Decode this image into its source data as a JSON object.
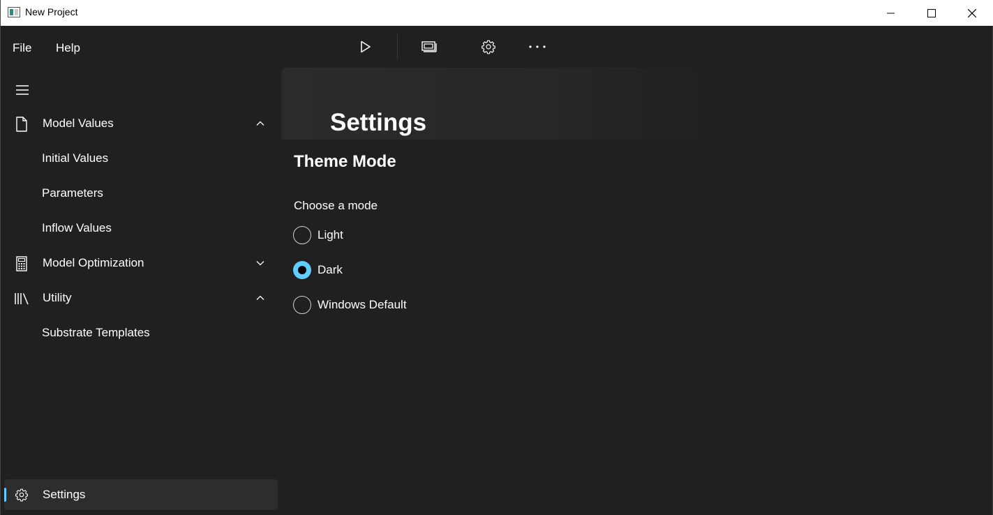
{
  "window": {
    "title": "New Project"
  },
  "menubar": {
    "items": [
      {
        "label": "File"
      },
      {
        "label": "Help"
      }
    ]
  },
  "commandbar": {
    "icons": [
      "play-icon",
      "screens-icon",
      "gear-icon",
      "more-icon"
    ]
  },
  "nav": {
    "items": [
      {
        "label": "Model Values",
        "icon": "document-icon",
        "expanded": true
      },
      {
        "label": "Initial Values"
      },
      {
        "label": "Parameters"
      },
      {
        "label": "Inflow Values"
      },
      {
        "label": "Model Optimization",
        "icon": "calculator-icon",
        "expanded": false
      },
      {
        "label": "Utility",
        "icon": "library-icon",
        "expanded": true
      },
      {
        "label": "Substrate Templates"
      }
    ],
    "footer": {
      "label": "Settings",
      "icon": "gear-icon",
      "selected": true
    }
  },
  "content": {
    "page_title": "Settings",
    "section_title": "Theme Mode",
    "radio_group_label": "Choose a mode",
    "options": [
      {
        "label": "Light",
        "checked": false
      },
      {
        "label": "Dark",
        "checked": true
      },
      {
        "label": "Windows Default",
        "checked": false
      }
    ]
  },
  "colors": {
    "accent": "#60cdff",
    "background": "#202020",
    "titlebar": "#ffffff"
  }
}
